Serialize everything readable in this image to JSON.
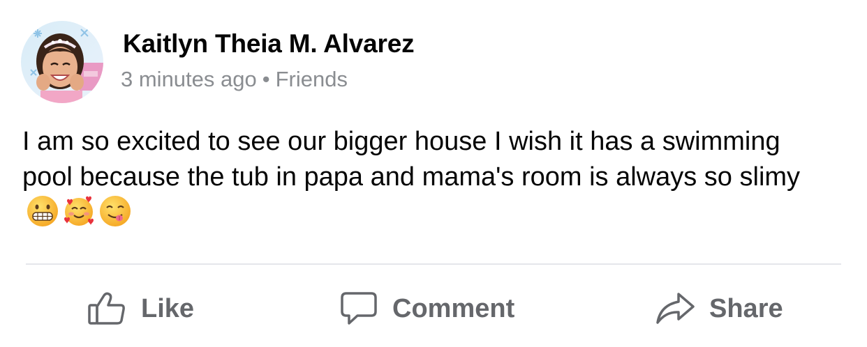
{
  "post": {
    "author_name": "Kaitlyn Theia M. Alvarez",
    "timestamp": "3 minutes ago",
    "separator": "•",
    "audience": "Friends",
    "text": "I am so excited to see our bigger house I wish it has a swimming pool because the tub in papa and mama's room is always so slimy",
    "emojis": [
      "grimacing-face-emoji",
      "smiling-face-with-hearts-emoji",
      "face-savoring-food-emoji"
    ]
  },
  "actions": {
    "like_label": "Like",
    "comment_label": "Comment",
    "share_label": "Share"
  },
  "icons": {
    "like": "thumbs-up-icon",
    "comment": "speech-bubble-icon",
    "share": "share-arrow-icon"
  },
  "colors": {
    "text_primary": "#050505",
    "text_secondary": "#8a8d91",
    "action_gray": "#65676b",
    "divider": "#e4e6eb"
  }
}
